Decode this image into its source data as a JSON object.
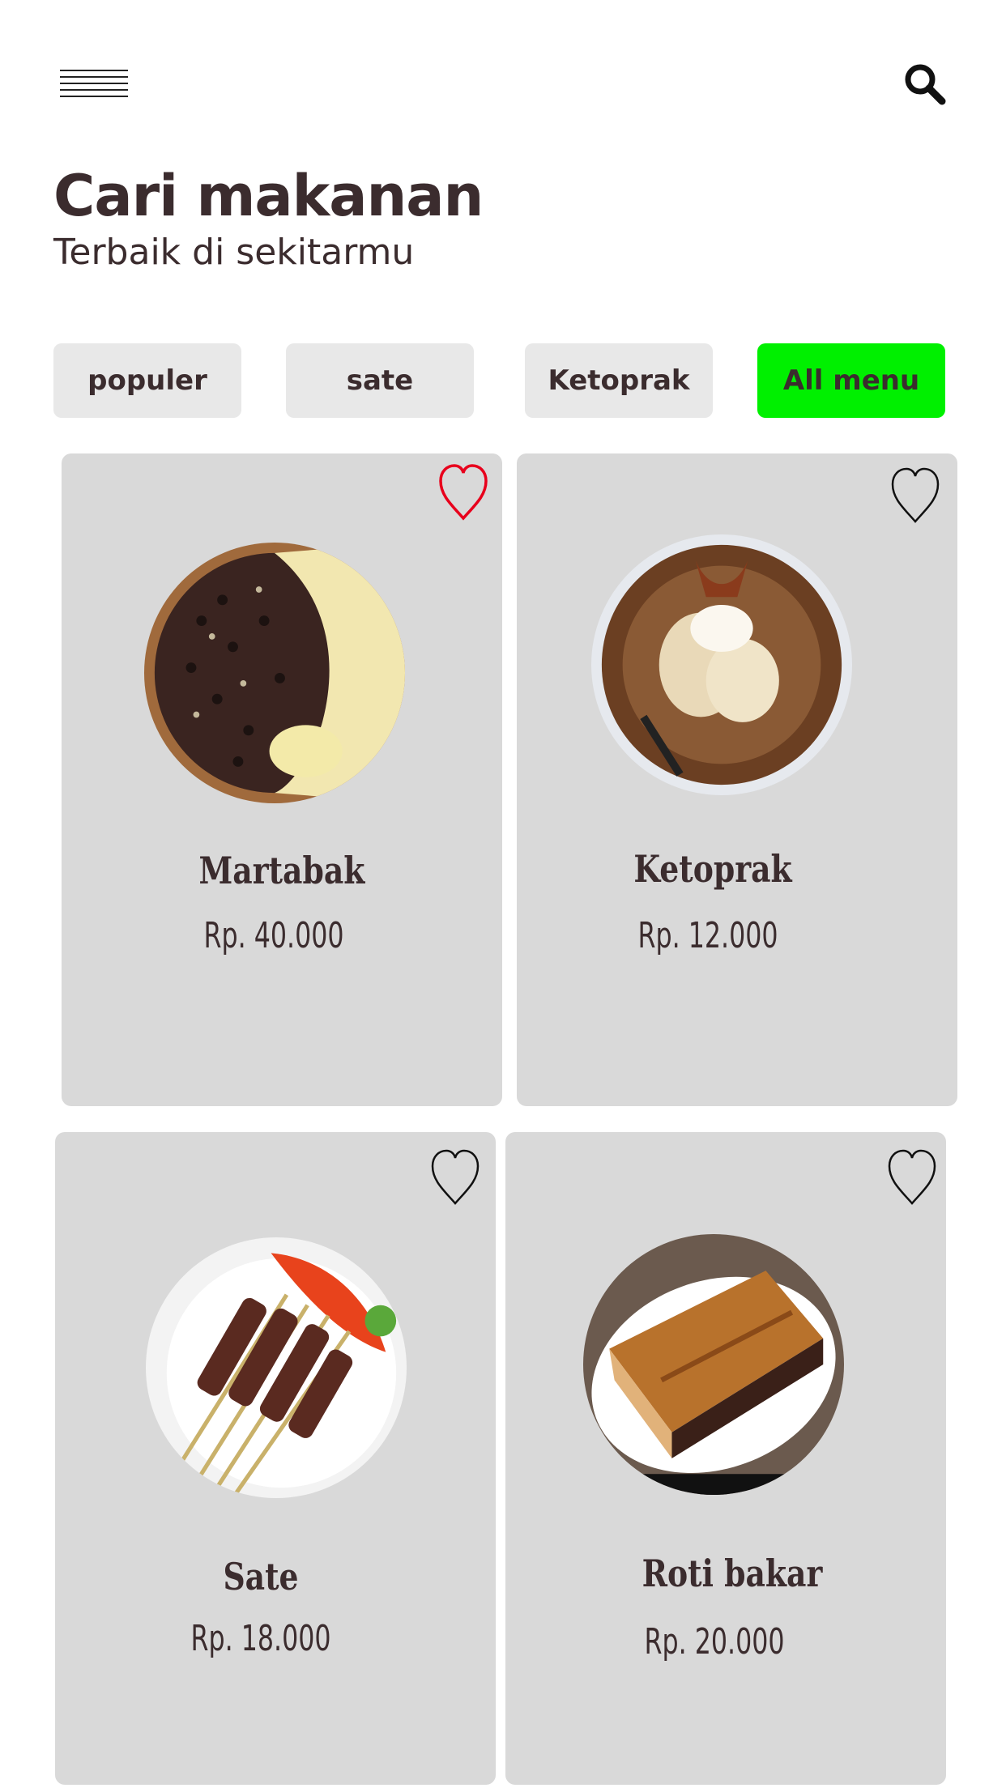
{
  "header": {
    "menu_icon": "hamburger-menu-icon",
    "search_icon": "search-icon"
  },
  "heading": {
    "title": "Cari makanan",
    "subtitle": "Terbaik di sekitarmu"
  },
  "filters": [
    {
      "label": "populer",
      "active": false
    },
    {
      "label": "sate",
      "active": false
    },
    {
      "label": "Ketoprak",
      "active": false
    },
    {
      "label": "All menu",
      "active": true
    }
  ],
  "colors": {
    "accent": "#00f000",
    "chip": "#e8e8e8",
    "card": "#d9d9d9",
    "text": "#3b2c2e",
    "heart_favorited": "#e8001c"
  },
  "items": [
    {
      "name": "Martabak",
      "price": "Rp. 40.000",
      "favorited": true,
      "image": "martabak-photo"
    },
    {
      "name": "Ketoprak",
      "price": "Rp. 12.000",
      "favorited": false,
      "image": "ketoprak-photo"
    },
    {
      "name": "Sate",
      "price": "Rp. 18.000",
      "favorited": false,
      "image": "sate-photo"
    },
    {
      "name": "Roti bakar",
      "price": "Rp. 20.000",
      "favorited": false,
      "image": "roti-bakar-photo"
    }
  ]
}
